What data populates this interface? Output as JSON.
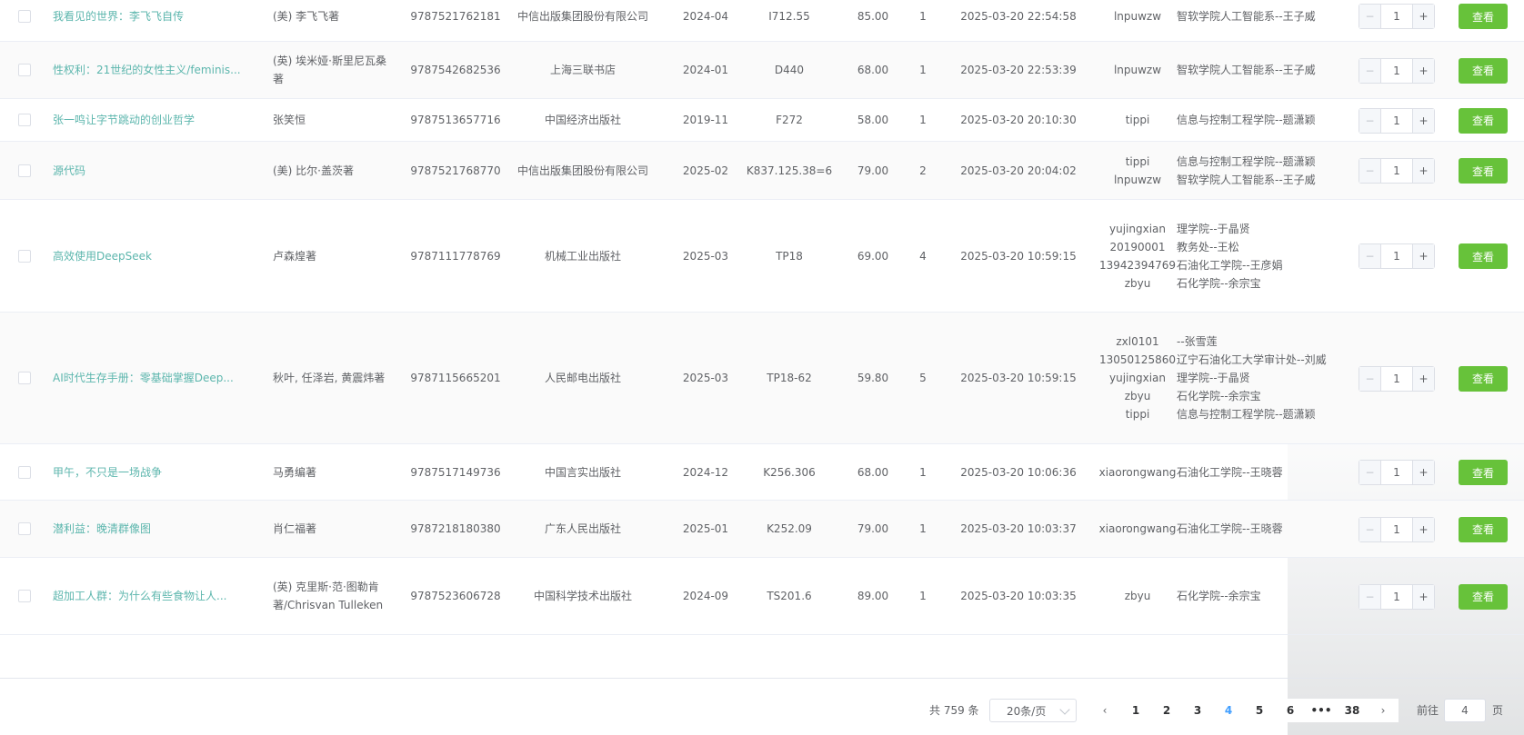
{
  "rows": [
    {
      "title": "我看见的世界：李飞飞自传",
      "author": "(美) 李飞飞著",
      "isbn": "9787521762181",
      "publisher": "中信出版集团股份有限公司",
      "date": "2024-04",
      "class_no": "I712.55",
      "price": "85.00",
      "count": "1",
      "time": "2025-03-20 22:54:58",
      "users": "lnpuwzw",
      "depts": "智软学院人工智能系--王子威",
      "qty": "1",
      "action": "查看"
    },
    {
      "title": "性权利：21世纪的女性主义/feminis...",
      "author": "(英) 埃米娅·斯里尼瓦桑著",
      "isbn": "9787542682536",
      "publisher": "上海三联书店",
      "date": "2024-01",
      "class_no": "D440",
      "price": "68.00",
      "count": "1",
      "time": "2025-03-20 22:53:39",
      "users": "lnpuwzw",
      "depts": "智软学院人工智能系--王子威",
      "qty": "1",
      "action": "查看"
    },
    {
      "title": "张一鸣让字节跳动的创业哲学",
      "author": "张笑恒",
      "isbn": "9787513657716",
      "publisher": "中国经济出版社",
      "date": "2019-11",
      "class_no": "F272",
      "price": "58.00",
      "count": "1",
      "time": "2025-03-20 20:10:30",
      "users": "tippi",
      "depts": "信息与控制工程学院--题潇颖",
      "qty": "1",
      "action": "查看"
    },
    {
      "title": "源代码",
      "author": "(美) 比尔·盖茨著",
      "isbn": "9787521768770",
      "publisher": "中信出版集团股份有限公司",
      "date": "2025-02",
      "class_no": "K837.125.38=6",
      "price": "79.00",
      "count": "2",
      "time": "2025-03-20 20:04:02",
      "users": "tippi\nlnpuwzw",
      "depts": "信息与控制工程学院--题潇颖\n智软学院人工智能系--王子威",
      "qty": "1",
      "action": "查看"
    },
    {
      "title": "高效使用DeepSeek",
      "author": "卢森煌著",
      "isbn": "9787111778769",
      "publisher": "机械工业出版社",
      "date": "2025-03",
      "class_no": "TP18",
      "price": "69.00",
      "count": "4",
      "time": "2025-03-20 10:59:15",
      "users": "yujingxian\n20190001\n13942394769\nzbyu",
      "depts": "理学院--于晶贤\n教务处--王松\n石油化工学院--王彦娟\n石化学院--余宗宝",
      "qty": "1",
      "action": "查看"
    },
    {
      "title": "AI时代生存手册：零基础掌握Deep...",
      "author": "秋叶, 任泽岩, 黄震炜著",
      "isbn": "9787115665201",
      "publisher": "人民邮电出版社",
      "date": "2025-03",
      "class_no": "TP18-62",
      "price": "59.80",
      "count": "5",
      "time": "2025-03-20 10:59:15",
      "users": "zxl0101\n13050125860\nyujingxian\nzbyu\ntippi",
      "depts": "--张雪莲\n辽宁石油化工大学审计处--刘威\n理学院--于晶贤\n石化学院--余宗宝\n信息与控制工程学院--题潇颖",
      "qty": "1",
      "action": "查看"
    },
    {
      "title": "甲午，不只是一场战争",
      "author": "马勇编著",
      "isbn": "9787517149736",
      "publisher": "中国言实出版社",
      "date": "2024-12",
      "class_no": "K256.306",
      "price": "68.00",
      "count": "1",
      "time": "2025-03-20 10:06:36",
      "users": "xiaorongwang",
      "depts": "石油化工学院--王晓蓉",
      "qty": "1",
      "action": "查看"
    },
    {
      "title": "潜利益：晚清群像图",
      "author": "肖仁福著",
      "isbn": "9787218180380",
      "publisher": "广东人民出版社",
      "date": "2025-01",
      "class_no": "K252.09",
      "price": "79.00",
      "count": "1",
      "time": "2025-03-20 10:03:37",
      "users": "xiaorongwang",
      "depts": "石油化工学院--王晓蓉",
      "qty": "1",
      "action": "查看"
    },
    {
      "title": "超加工人群：为什么有些食物让人...",
      "author": "(英) 克里斯·范·图勒肯著/Chrisvan Tulleken",
      "isbn": "9787523606728",
      "publisher": "中国科学技术出版社",
      "date": "2024-09",
      "class_no": "TS201.6",
      "price": "89.00",
      "count": "1",
      "time": "2025-03-20 10:03:35",
      "users": "zbyu",
      "depts": "石化学院--余宗宝",
      "qty": "1",
      "action": "查看"
    }
  ],
  "stepper": {
    "minus": "−",
    "plus": "+"
  },
  "pagination": {
    "total_text": "共 759 条",
    "page_size": "20条/页",
    "prev": "‹",
    "next": "›",
    "pages": [
      "1",
      "2",
      "3",
      "4",
      "5",
      "6",
      "•••",
      "38"
    ],
    "current": "4",
    "jump_label": "前往",
    "jump_value": "4",
    "jump_suffix": "页"
  }
}
